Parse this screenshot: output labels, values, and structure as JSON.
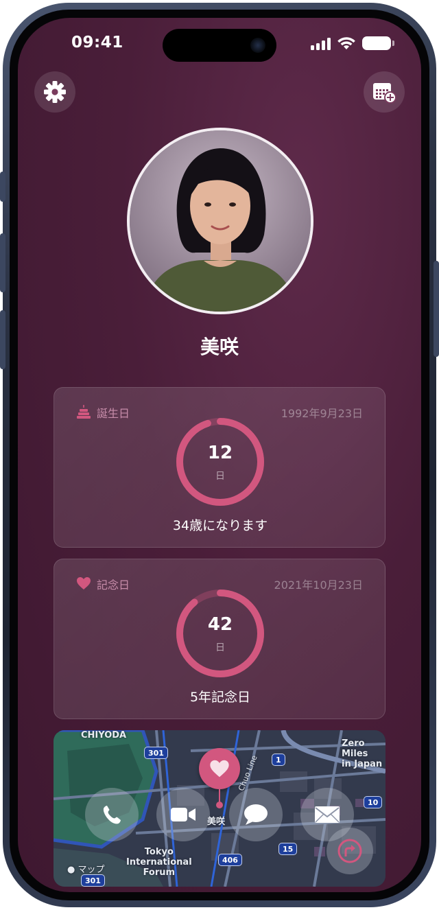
{
  "status_bar": {
    "time": "09:41"
  },
  "toolbar": {
    "settings_icon": "gear-icon",
    "calendar_add_icon": "calendar-add-icon"
  },
  "profile": {
    "name": "美咲",
    "photo": "portrait photo"
  },
  "birthday_card": {
    "icon": "birthday-cake-icon",
    "label": "誕生日",
    "date": "1992年9月23日",
    "days_remaining": "12",
    "unit": "日",
    "caption": "34歳になります",
    "ring_progress": 0.95,
    "accent": "#d2577f"
  },
  "anniversary_card": {
    "icon": "heart-icon",
    "label": "記念日",
    "date": "2021年10月23日",
    "days_remaining": "42",
    "unit": "日",
    "caption": "5年記念日",
    "ring_progress": 0.89,
    "accent": "#d2577f"
  },
  "map": {
    "labels": {
      "chiyoda": "CHIYODA",
      "zero_miles_1": "Zero Miles",
      "zero_miles_2": "in Japan",
      "chuo_line": "Chuo Line",
      "tokyo_forum_1": "Tokyo",
      "tokyo_forum_2": "International",
      "tokyo_forum_3": "Forum",
      "pin_label": "美咲",
      "attribution": "マップ"
    },
    "route_shields": [
      "301",
      "1",
      "10",
      "406",
      "15",
      "301"
    ]
  },
  "actions": [
    {
      "name": "call",
      "icon": "phone-icon"
    },
    {
      "name": "video",
      "icon": "video-camera-icon"
    },
    {
      "name": "message",
      "icon": "message-bubble-icon"
    },
    {
      "name": "mail",
      "icon": "envelope-icon"
    },
    {
      "name": "directions",
      "icon": "directions-icon"
    }
  ]
}
